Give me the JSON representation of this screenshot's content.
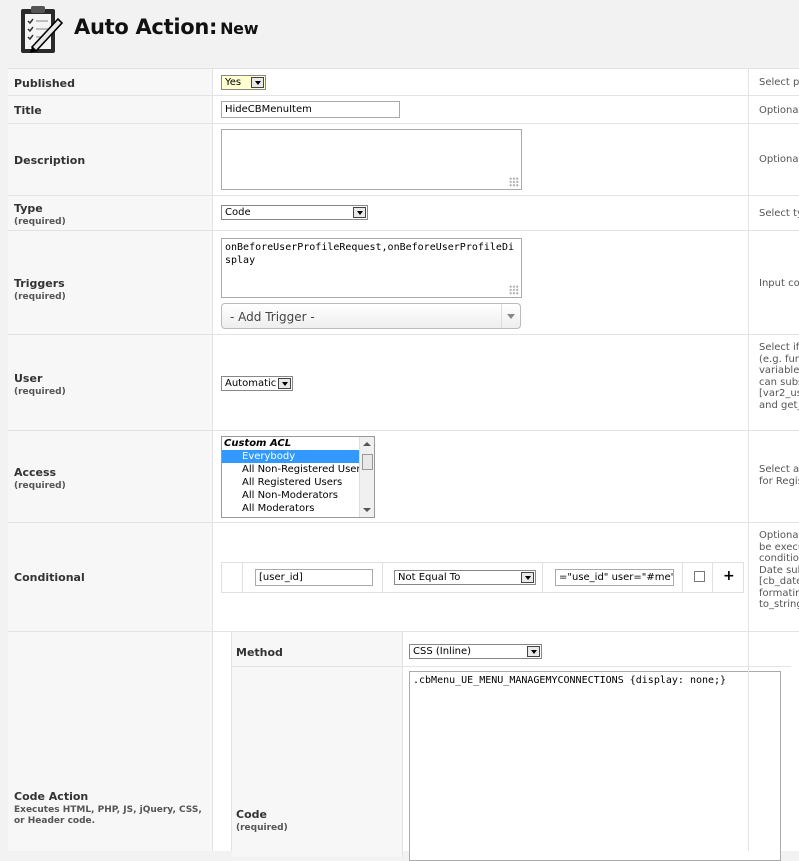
{
  "header": {
    "title": "Auto Action:",
    "subtitle": "New",
    "icon": "clipboard-pencil-icon"
  },
  "fields": {
    "published": {
      "label": "Published",
      "value": "Yes",
      "desc": "Select pu"
    },
    "title": {
      "label": "Title",
      "value": "HideCBMenuItem",
      "desc": "Optionall"
    },
    "description": {
      "label": "Description",
      "value": "",
      "desc": "Optionall"
    },
    "type": {
      "label": "Type",
      "required": "(required)",
      "value": "Code",
      "desc": "Select ty"
    },
    "triggers": {
      "label": "Triggers",
      "required": "(required)",
      "value": "onBeforeUserProfileRequest,onBeforeUserProfileDisplay",
      "add_placeholder": "- Add Trigger -",
      "desc": "Input con"
    },
    "user": {
      "label": "User",
      "required": "(required)",
      "value": "Automatic",
      "desc_lines": [
        "Select if",
        "(e.g. fun",
        "variable",
        "can subs",
        "[var2_us",
        "and get_"
      ]
    },
    "access": {
      "label": "Access",
      "required": "(required)",
      "group": "Custom ACL",
      "options": [
        "Everybody",
        "All Non-Registered Users",
        "All Registered Users",
        "All Non-Moderators",
        "All Moderators"
      ],
      "selected": "Everybody",
      "desc_lines": [
        "Select ac",
        "for Regis"
      ]
    },
    "conditional": {
      "label": "Conditional",
      "field": "[user_id]",
      "operator": "Not Equal To",
      "value": "=\"use_id\" user=\"#me\" /]",
      "desc_lines": [
        "Optionall",
        "be execu",
        "conditio",
        "Date sub",
        "[cb_date",
        "formatin",
        "to_string"
      ]
    },
    "code_action": {
      "label": "Code Action",
      "note": "Executes HTML, PHP, JS, jQuery, CSS, or Header code.",
      "method_label": "Method",
      "method_value": "CSS (Inline)",
      "code_label": "Code",
      "code_required": "(required)",
      "code_value": ".cbMenu_UE_MENU_MANAGEMYCONNECTIONS {display: none;}"
    }
  }
}
